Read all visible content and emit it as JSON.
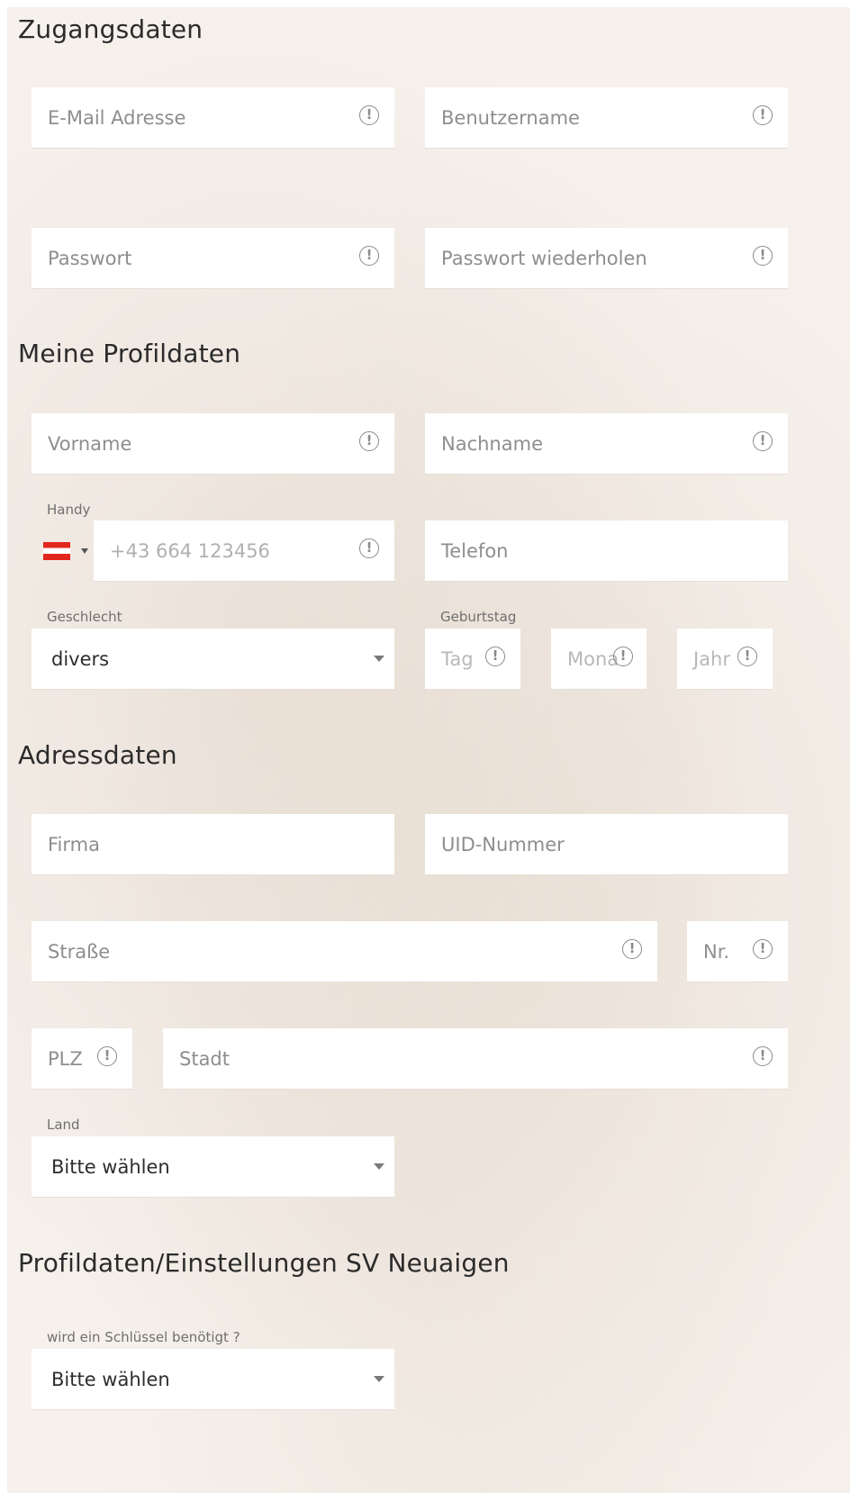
{
  "sections": {
    "access": "Zugangsdaten",
    "profile": "Meine Profildaten",
    "address": "Adressdaten",
    "settings": "Profildaten/Einstellungen SV Neuaigen"
  },
  "fields": {
    "email": "E-Mail Adresse",
    "username": "Benutzername",
    "password": "Passwort",
    "password_repeat": "Passwort wiederholen",
    "firstname": "Vorname",
    "lastname": "Nachname",
    "mobile_label": "Handy",
    "mobile_placeholder": "+43 664 123456",
    "phone": "Telefon",
    "gender_label": "Geschlecht",
    "gender_value": "divers",
    "birthday_label": "Geburtstag",
    "day": "Tag",
    "month": "Mona",
    "year": "Jahr",
    "company": "Firma",
    "vat": "UID-Nummer",
    "street": "Straße",
    "number": "Nr.",
    "zip": "PLZ",
    "city": "Stadt",
    "country_label": "Land",
    "country_value": "Bitte wählen",
    "key_label": "wird ein Schlüssel benötigt ?",
    "key_value": "Bitte wählen"
  },
  "icons": {
    "alert": "!",
    "flag": "austria-flag-icon",
    "dropdown": "caret-down-icon"
  },
  "colors": {
    "background": "#f6f1ec",
    "field": "#ffffff",
    "placeholder": "#8e8e8e",
    "flag_red": "#e2261c"
  }
}
